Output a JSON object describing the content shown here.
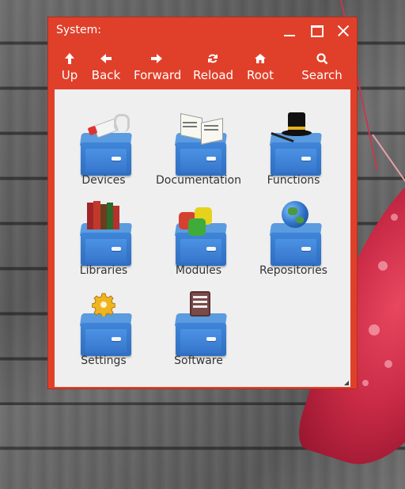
{
  "window": {
    "title": "System:",
    "accent": "#e0402a"
  },
  "toolbar": [
    {
      "label": "Up",
      "icon": "arrow-up-icon",
      "glyph": "🡅"
    },
    {
      "label": "Back",
      "icon": "arrow-left-icon",
      "glyph": "🡄"
    },
    {
      "label": "Forward",
      "icon": "arrow-right-icon",
      "glyph": "🡆"
    },
    {
      "label": "Reload",
      "icon": "reload-icon",
      "glyph": "⟳"
    },
    {
      "label": "Root",
      "icon": "home-icon",
      "glyph": "⌂"
    },
    {
      "label": "Search",
      "icon": "search-icon",
      "glyph": "⌕"
    }
  ],
  "items": [
    {
      "label": "Devices",
      "icon": "devices-drawer-icon"
    },
    {
      "label": "Documentation",
      "icon": "documentation-drawer-icon"
    },
    {
      "label": "Functions",
      "icon": "functions-drawer-icon"
    },
    {
      "label": "Libraries",
      "icon": "libraries-drawer-icon"
    },
    {
      "label": "Modules",
      "icon": "modules-drawer-icon"
    },
    {
      "label": "Repositories",
      "icon": "repositories-drawer-icon"
    },
    {
      "label": "Settings",
      "icon": "settings-drawer-icon"
    },
    {
      "label": "Software",
      "icon": "software-drawer-icon"
    }
  ]
}
